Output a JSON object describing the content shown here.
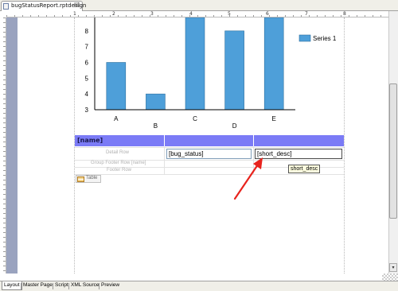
{
  "editor_tab": {
    "title": "bugStatusReport.rptdesign",
    "close": "☒"
  },
  "ruler_top_numbers": [
    "1",
    "2",
    "3",
    "4",
    "5",
    "6",
    "7",
    "8"
  ],
  "chart_data": {
    "type": "bar",
    "categories": [
      "A",
      "B",
      "C",
      "D",
      "E"
    ],
    "series": [
      {
        "name": "Series 1",
        "values": [
          6,
          4,
          9,
          8,
          9
        ]
      }
    ],
    "y_ticks": [
      "3",
      "4",
      "5",
      "6",
      "7",
      "8"
    ],
    "ylim": [
      3,
      8.9
    ],
    "legend_position": "right",
    "colors": {
      "bar": "#4e9fd9",
      "bar_border": "#2c6f9e"
    }
  },
  "table": {
    "header_name": "[name]",
    "detail_row_label": "Detail Row",
    "group_footer_label": "Group Footer Row [name]",
    "footer_row_label": "Footer Row",
    "bug_status_field": "[bug_status]",
    "short_desc_field": "[short_desc]",
    "tooltip": "short_desc",
    "handle_label": "Table",
    "header_color": "#7b7bf6"
  },
  "annotation": {
    "arrow_color": "#e8231d"
  },
  "bottom_tabs": [
    "Layout",
    "Master Page",
    "Script",
    "XML Source",
    "Preview"
  ],
  "scroll_down_glyph": "▾"
}
